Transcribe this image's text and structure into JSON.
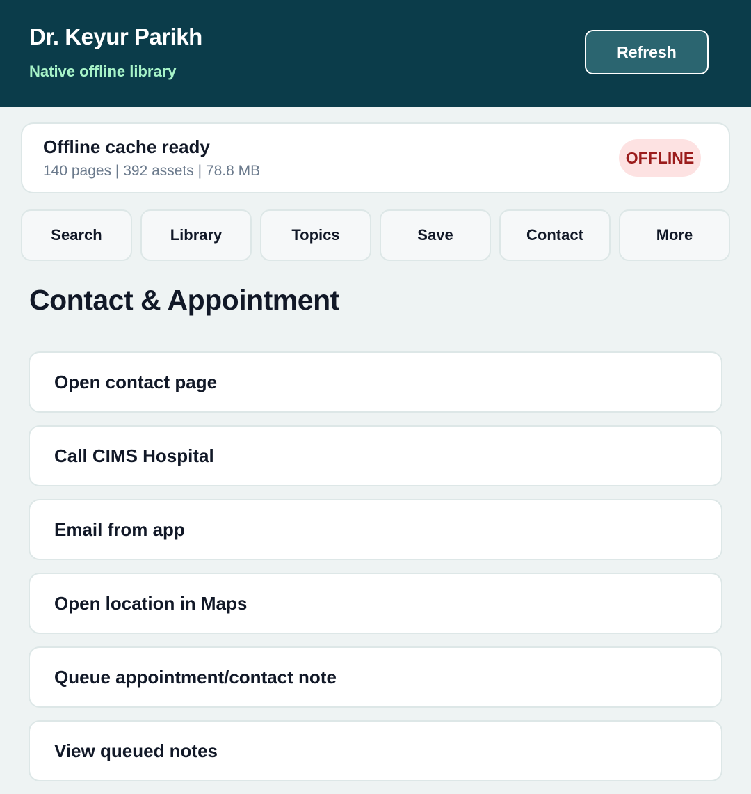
{
  "header": {
    "title": "Dr. Keyur Parikh",
    "subtitle": "Native offline library",
    "refresh_label": "Refresh"
  },
  "status": {
    "title": "Offline cache ready",
    "meta": "140 pages | 392 assets | 78.8 MB",
    "badge": "OFFLINE"
  },
  "nav": {
    "tabs": [
      {
        "label": "Search"
      },
      {
        "label": "Library"
      },
      {
        "label": "Topics"
      },
      {
        "label": "Save"
      },
      {
        "label": "Contact"
      },
      {
        "label": "More"
      }
    ]
  },
  "main": {
    "title": "Contact & Appointment",
    "actions": [
      {
        "label": "Open contact page"
      },
      {
        "label": "Call CIMS Hospital"
      },
      {
        "label": "Email from app"
      },
      {
        "label": "Open location in Maps"
      },
      {
        "label": "Queue appointment/contact note"
      },
      {
        "label": "View queued notes"
      }
    ]
  },
  "colors": {
    "header_bg": "#0b3c4a",
    "accent_green": "#a7f3c8",
    "badge_bg": "#fde2e2",
    "badge_text": "#9b1c1c",
    "page_bg": "#eef3f3"
  }
}
